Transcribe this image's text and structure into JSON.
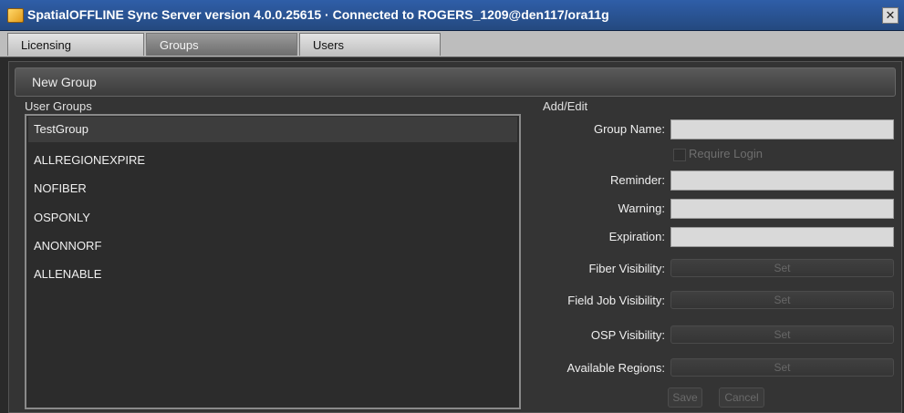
{
  "window": {
    "title": "SpatialOFFLINE Sync Server version 4.0.0.25615 · Connected to ROGERS_1209@den117/ora11g",
    "close_glyph": "✕"
  },
  "tabs": [
    {
      "label": "Licensing",
      "active": false
    },
    {
      "label": "Groups",
      "active": true
    },
    {
      "label": "Users",
      "active": false
    }
  ],
  "toolbar": {
    "new_group_label": "New Group"
  },
  "user_groups": {
    "label": "User Groups",
    "items": [
      "TestGroup",
      "ALLREGIONEXPIRE",
      "NOFIBER",
      "OSPONLY",
      "ANONNORF",
      "ALLENABLE"
    ],
    "selected_index": 0
  },
  "add_edit": {
    "label": "Add/Edit",
    "group_name_label": "Group Name:",
    "group_name_value": "",
    "require_login_label": "Require Login",
    "require_login_checked": false,
    "reminder_label": "Reminder:",
    "reminder_value": "",
    "warning_label": "Warning:",
    "warning_value": "",
    "expiration_label": "Expiration:",
    "expiration_value": "",
    "fiber_visibility_label": "Fiber Visibility:",
    "field_job_visibility_label": "Field Job Visibility:",
    "osp_visibility_label": "OSP Visibility:",
    "available_regions_label": "Available Regions:",
    "set_label": "Set",
    "save_label": "Save",
    "cancel_label": "Cancel"
  },
  "colors": {
    "titlebar": "#2f5ea8",
    "panel": "#343434",
    "input_bg": "#d9d9d9",
    "disabled_text": "#6a6a6a"
  }
}
